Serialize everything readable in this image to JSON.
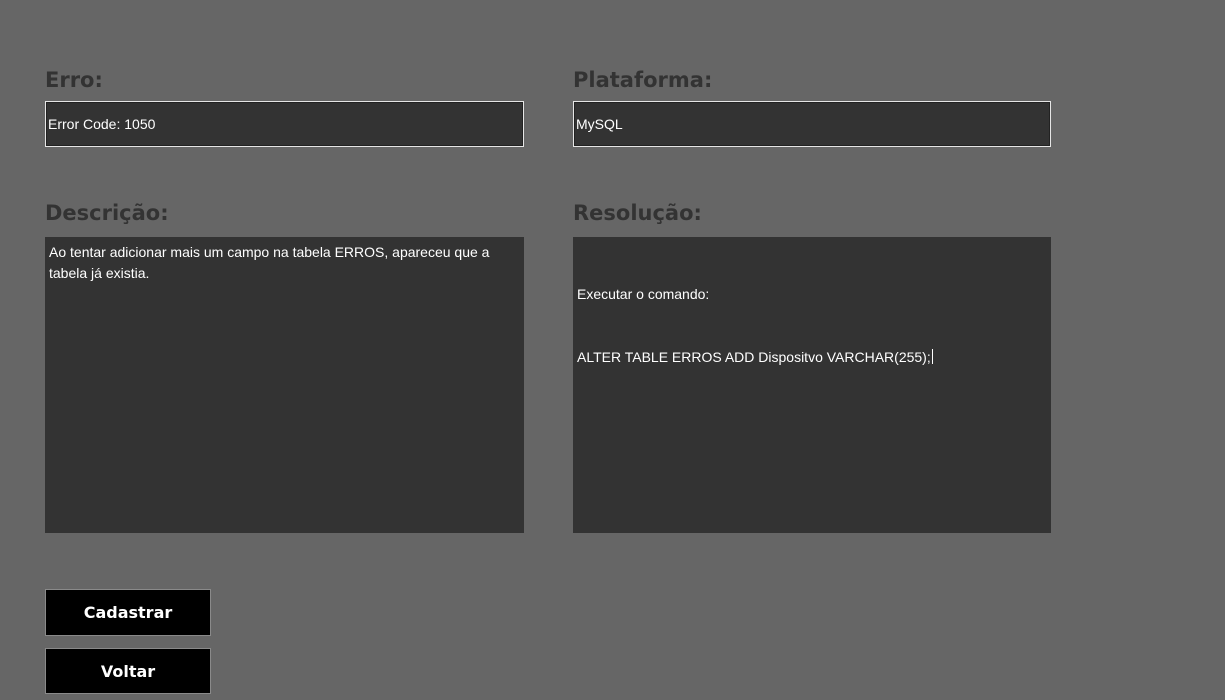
{
  "form": {
    "erro": {
      "label": "Erro:",
      "value": "Error Code: 1050"
    },
    "plataforma": {
      "label": "Plataforma:",
      "value": "MySQL"
    },
    "descricao": {
      "label": "Descrição:",
      "value": "Ao tentar adicionar mais um campo na tabela ERROS, apareceu que a tabela já existia."
    },
    "resolucao": {
      "label": "Resolução:",
      "line1": "Executar o comando:",
      "line2": "ALTER TABLE ERROS ADD Dispositvo VARCHAR(255);"
    }
  },
  "buttons": {
    "cadastrar": "Cadastrar",
    "voltar": "Voltar"
  },
  "colors": {
    "background": "#666666",
    "field": "#333333",
    "label": "#333333",
    "button": "#000000",
    "text": "#ffffff"
  }
}
